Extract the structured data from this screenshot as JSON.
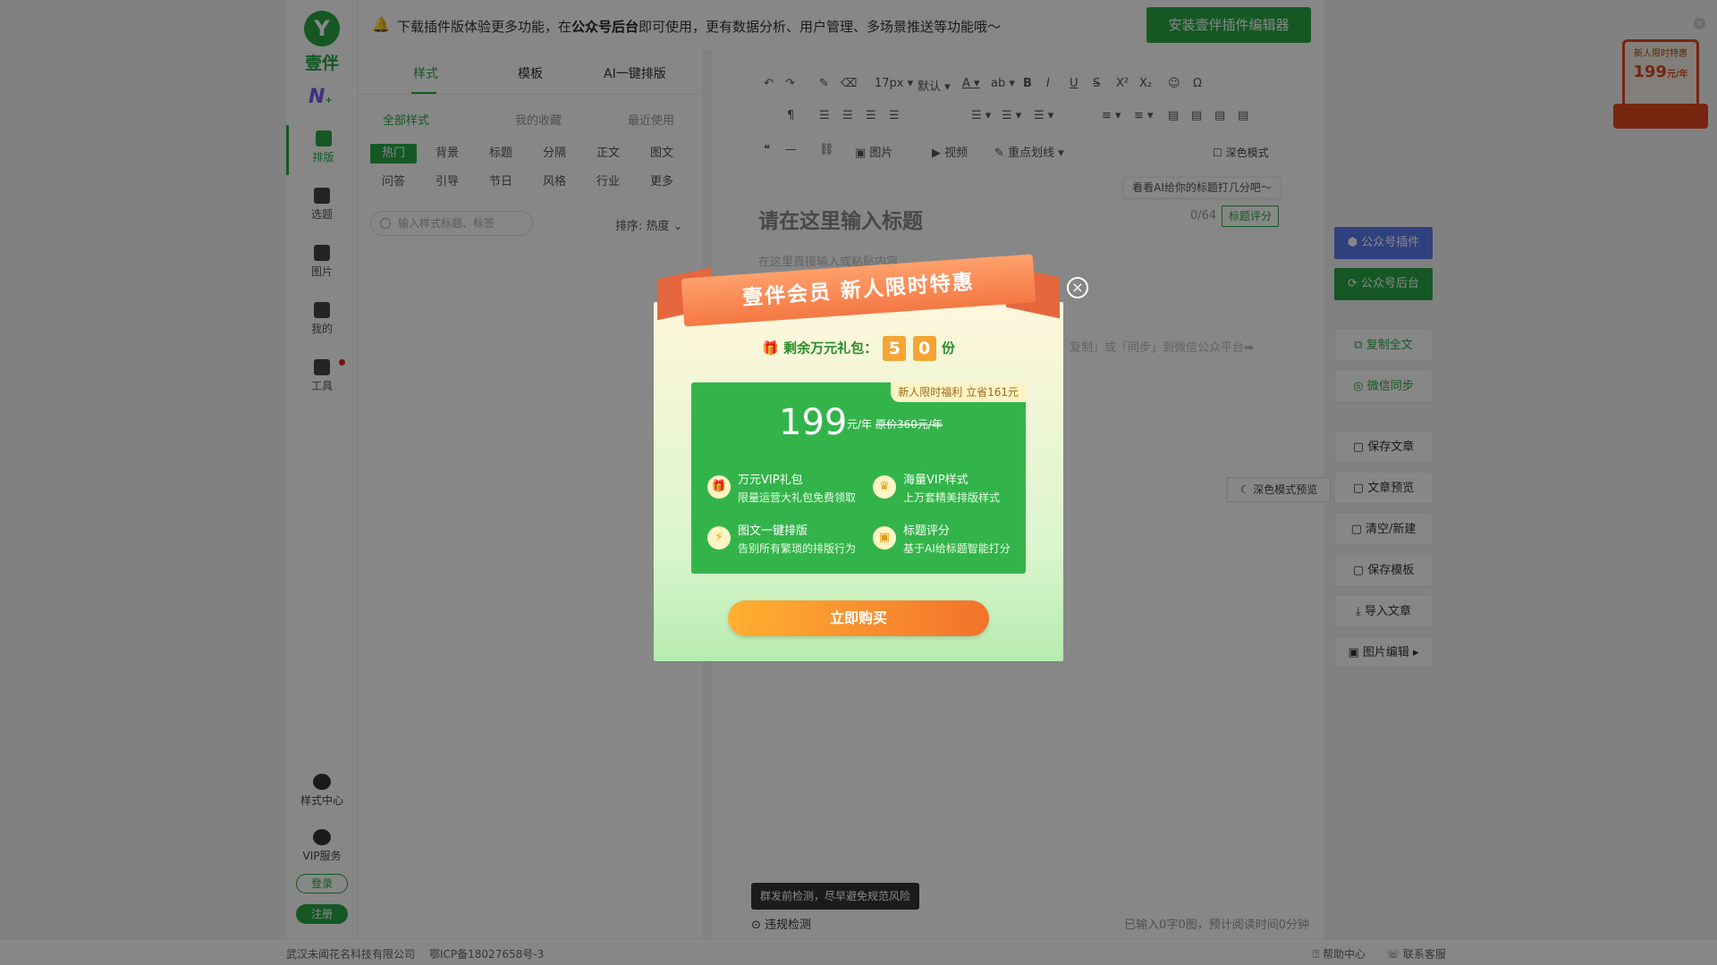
{
  "brand": {
    "logo_letter": "Y",
    "name": "壹伴",
    "ai_logo": "N",
    "ai_plus": "+"
  },
  "nav": [
    {
      "label": "排版",
      "icon": "layout-icon"
    },
    {
      "label": "选题",
      "icon": "bookmark-icon"
    },
    {
      "label": "图片",
      "icon": "image-icon"
    },
    {
      "label": "我的",
      "icon": "document-icon"
    },
    {
      "label": "工具",
      "icon": "toolbox-icon"
    }
  ],
  "nav_bottom": {
    "style_center": "样式中心",
    "vip": "VIP服务",
    "login": "登录",
    "register": "注册"
  },
  "banner": {
    "text_before": "下载插件版体验更多功能，在",
    "text_bold": "公众号后台",
    "text_after": "即可使用，更有数据分析、用户管理、多场景推送等功能哦～",
    "install_label": "安装壹伴插件编辑器",
    "close": "×"
  },
  "style_panel": {
    "tabs": [
      "样式",
      "模板",
      "AI一键排版"
    ],
    "filters": [
      "全部样式",
      "我的收藏",
      "最近使用"
    ],
    "chips_row1": [
      "热门",
      "背景",
      "标题",
      "分隔",
      "正文",
      "图文"
    ],
    "chips_row2": [
      "问答",
      "引导",
      "节日",
      "风格",
      "行业",
      "更多"
    ],
    "search_placeholder": "输入样式标题、标签",
    "sort_label": "排序: 热度"
  },
  "toolbar": {
    "font_size": "17px",
    "font_default": "默认",
    "bold": "B",
    "italic": "I",
    "underline": "U",
    "strike": "S",
    "sup": "X²",
    "sub": "X₂",
    "image": "图片",
    "video": "视频",
    "highlight": "重点划线",
    "dark_mode": "深色模式"
  },
  "editor": {
    "ai_tip": "看看AI给你的标题打几分吧～",
    "title_placeholder": "请在这里输入标题",
    "title_count": "0/64",
    "title_score": "标题评分",
    "content_placeholder": "在这里直接输入或粘贴内容",
    "hint": "复制」或「同步」到微信公众平台➡",
    "risk_tip": "群发前检测，尽早避免规范风险",
    "risk_check": "违规检测",
    "word_count": "已输入0字0图，预计阅读时间0分钟",
    "dark_preview": "深色模式预览"
  },
  "right_actions": {
    "plugin": "公众号插件",
    "backend": "公众号后台",
    "copy_all": "复制全文",
    "wechat_sync": "微信同步",
    "save_article": "保存文章",
    "preview": "文章预览",
    "clear_new": "清空/新建",
    "save_template": "保存模板",
    "import_article": "导入文章",
    "image_edit": "图片编辑"
  },
  "promo_corner": {
    "line1": "新人限时特惠",
    "price": "199",
    "unit": "元/年"
  },
  "footer": {
    "company": "武汉未闻花名科技有限公司",
    "icp": "鄂ICP备18027658号-3",
    "help": "帮助中心",
    "service": "联系客服"
  },
  "modal": {
    "banner_title": "壹伴会员  新人限时特惠",
    "remain_label": "剩余万元礼包：",
    "digits": [
      "5",
      "0"
    ],
    "remain_unit": "份",
    "corner_tag": "新人限时福利 立省161元",
    "price": "199",
    "price_unit": "元/年",
    "price_original": "原价360元/年",
    "features": [
      {
        "title": "万元VIP礼包",
        "desc": "限量运营大礼包免费领取",
        "icon": "gift-icon"
      },
      {
        "title": "海量VIP样式",
        "desc": "上万套精美排版样式",
        "icon": "crown-icon"
      },
      {
        "title": "图文一键排版",
        "desc": "告别所有繁琐的排版行为",
        "icon": "lightning-icon"
      },
      {
        "title": "标题评分",
        "desc": "基于AI给标题智能打分",
        "icon": "score-icon"
      }
    ],
    "buy_label": "立即购买",
    "close": "×"
  }
}
